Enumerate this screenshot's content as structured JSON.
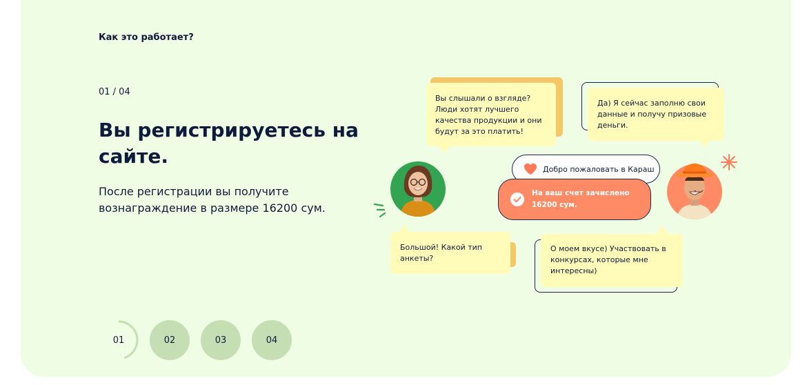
{
  "section": {
    "title": "Как это работает?"
  },
  "step": {
    "counter": "01 / 04",
    "heading": "Вы регистрируетесь на сайте.",
    "description": "После регистрации вы получите вознаграждение в размере 16200 сум."
  },
  "steps": [
    {
      "label": "01",
      "active": true,
      "progress": 0.45
    },
    {
      "label": "02",
      "active": false
    },
    {
      "label": "03",
      "active": false
    },
    {
      "label": "04",
      "active": false
    }
  ],
  "chat": {
    "bubble1": "Вы слышали о взгляде? Люди хотят лучшего качества продукции и они будут за это платить!",
    "bubble2": "Да) Я сейчас заполню свои данные и получу призовые деньги.",
    "welcome": "Добро пожаловать в Караш",
    "credited": "На ваш счет зачислено 16200 сум.",
    "bubble3": "Большой! Какой тип анкеты?",
    "bubble4": "О моем вкусе) Участвовать в конкурсах, которые мне интересны)"
  },
  "colors": {
    "background": "#eefde4",
    "text": "#0f1b3d",
    "step_inactive": "#c6deb4",
    "bubble": "#fffbb8",
    "accent_orange": "#ff8a66",
    "heart": "#ff7a59"
  },
  "icons": [
    "heart-icon",
    "check-circle-icon",
    "sparkle-icon"
  ]
}
